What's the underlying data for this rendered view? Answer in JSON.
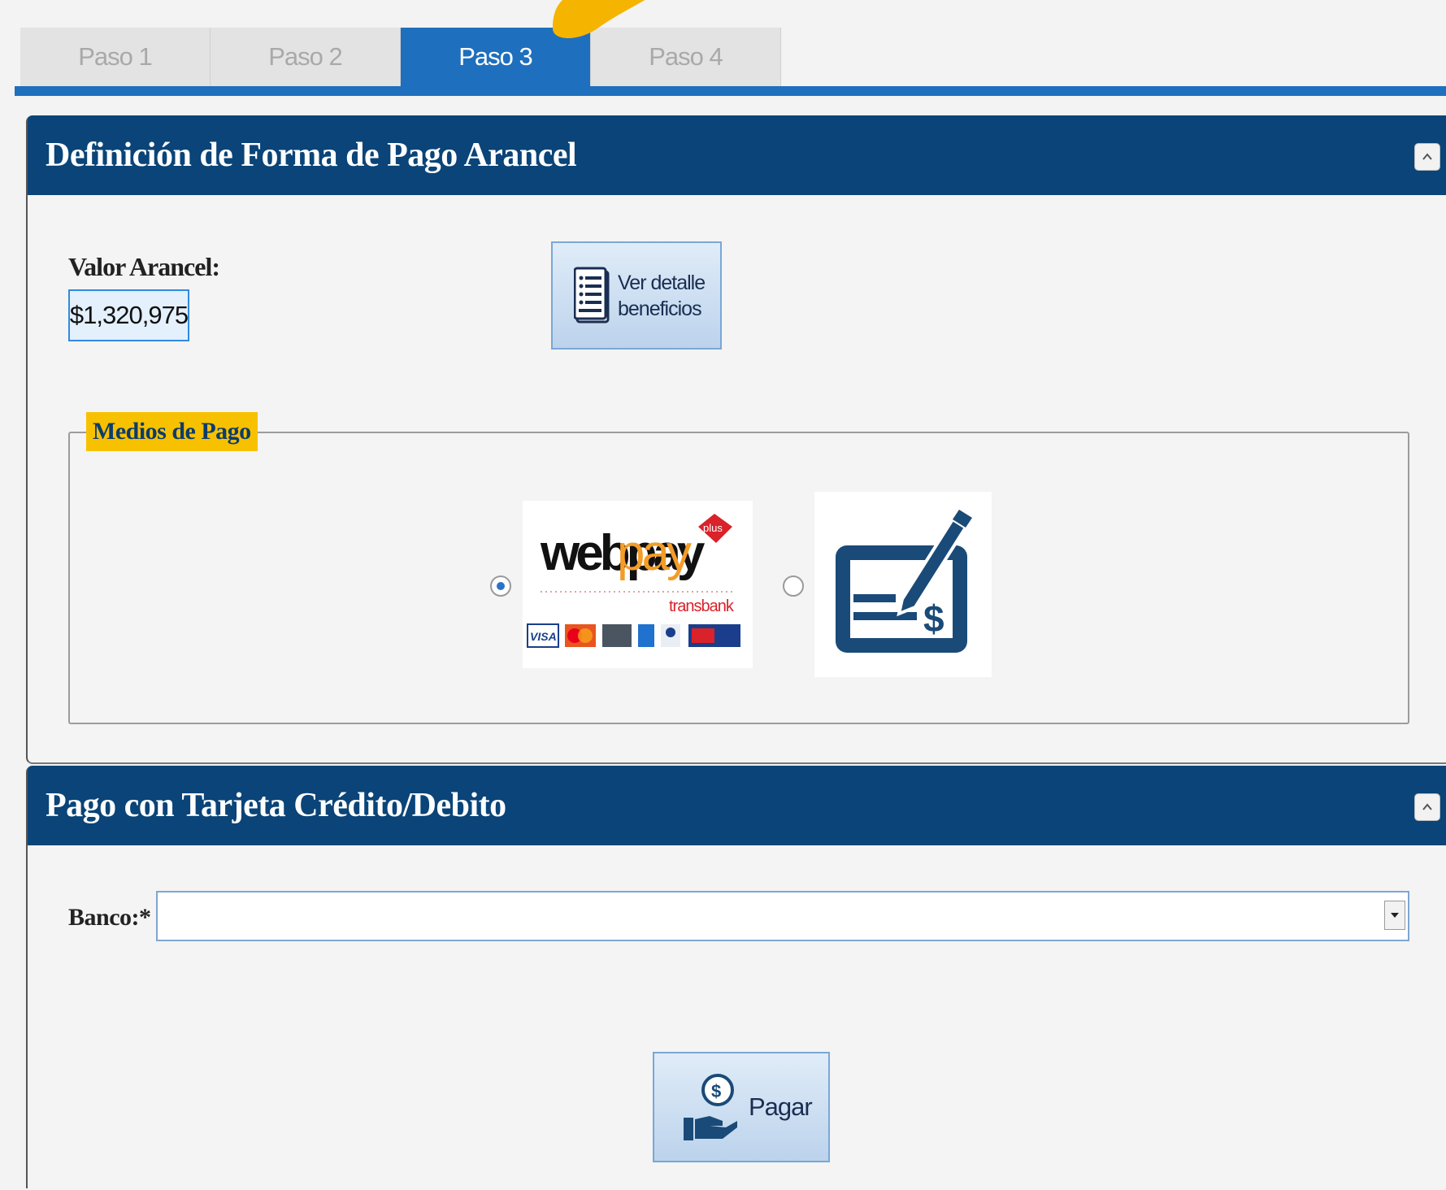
{
  "tabs": [
    {
      "label": "Paso 1",
      "active": false
    },
    {
      "label": "Paso 2",
      "active": false
    },
    {
      "label": "Paso 3",
      "active": true
    },
    {
      "label": "Paso 4",
      "active": false
    }
  ],
  "panel_forma_pago": {
    "title": "Definición de Forma de Pago Arancel",
    "valor_label": "Valor Arancel:",
    "valor": "$1,320,975",
    "detalle_button": "Ver detalle beneficios",
    "medios_legend": "Medios de Pago",
    "options": [
      {
        "name": "webpay",
        "selected": true,
        "logo_text": "webpay",
        "logo_badge": "plus",
        "logo_sub": "transbank"
      },
      {
        "name": "cheque",
        "selected": false
      }
    ]
  },
  "panel_tarjeta": {
    "title": "Pago con Tarjeta Crédito/Debito",
    "banco_label": "Banco:*",
    "banco_value": "",
    "pagar_button": "Pagar"
  },
  "colors": {
    "active_tab": "#1e6fbe",
    "header": "#0a4478",
    "legend_bg": "#f7c100",
    "accent_yellow": "#f4b400"
  }
}
